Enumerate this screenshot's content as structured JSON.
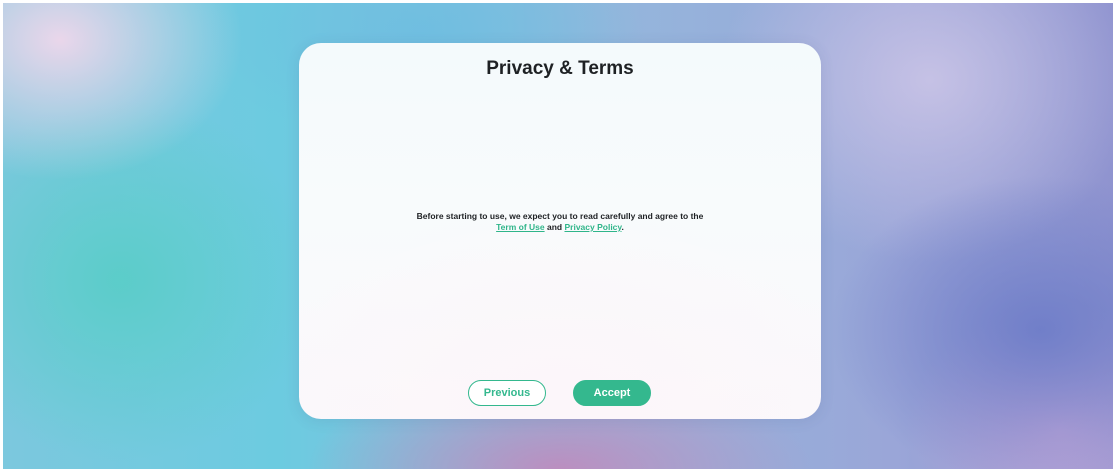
{
  "dialog": {
    "title": "Privacy & Terms",
    "message_prefix": "Before starting to use, we expect you to read carefully and agree to the",
    "terms_link": "Term of Use",
    "conjunction": "and",
    "privacy_link": "Privacy Policy",
    "message_suffix": "."
  },
  "buttons": {
    "previous_label": "Previous",
    "accept_label": "Accept"
  },
  "colors": {
    "accent": "#34b88e",
    "link": "#2fb58a",
    "text": "#1e2124"
  }
}
